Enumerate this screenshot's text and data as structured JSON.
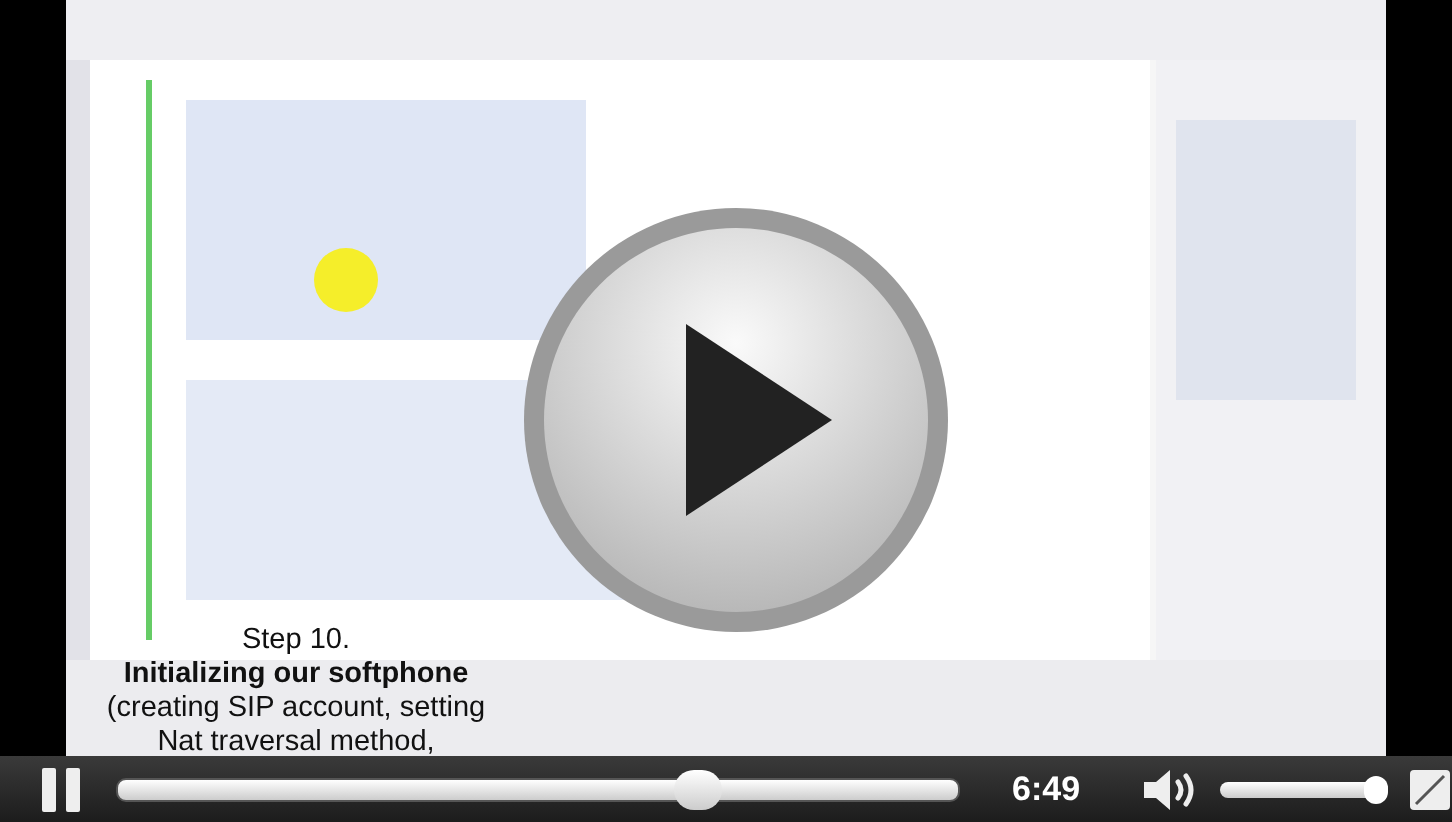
{
  "player": {
    "caption": [
      {
        "text": "Step 10.",
        "bold": false
      },
      {
        "text": "Initializing our softphone",
        "bold": true
      },
      {
        "text": "(creating SIP account, setting",
        "bold": false
      },
      {
        "text": "Nat traversal method,",
        "bold": false
      }
    ],
    "playing": true,
    "progress": {
      "level": 0.69
    },
    "time": "6:49",
    "volume": {
      "level": 0.93
    }
  }
}
